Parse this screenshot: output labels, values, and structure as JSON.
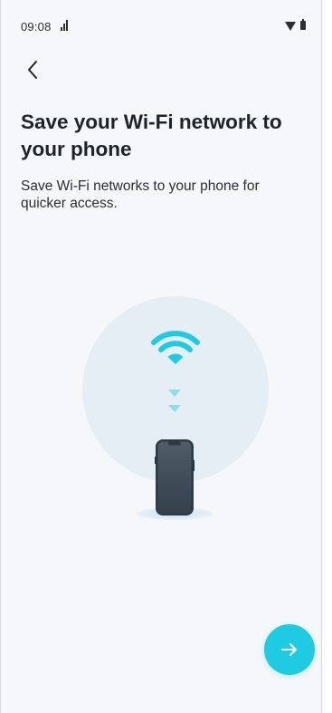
{
  "status_bar": {
    "time": "09:08"
  },
  "header": {
    "back_icon": "chevron-left-icon"
  },
  "content": {
    "title": "Save your Wi-Fi network to your phone",
    "subtitle": "Save Wi-Fi networks to your phone for quicker access."
  },
  "illustration": {
    "icons": [
      "wifi-icon",
      "down-arrow-icon",
      "down-arrow-icon",
      "phone-icon"
    ]
  },
  "footer": {
    "next_icon": "arrow-right-icon"
  },
  "colors": {
    "accent": "#1fcbe3",
    "background": "#f5f7fa",
    "illustration_circle": "#e6eef5",
    "phone_body": "#3a4650",
    "text_primary": "#1f2328"
  }
}
